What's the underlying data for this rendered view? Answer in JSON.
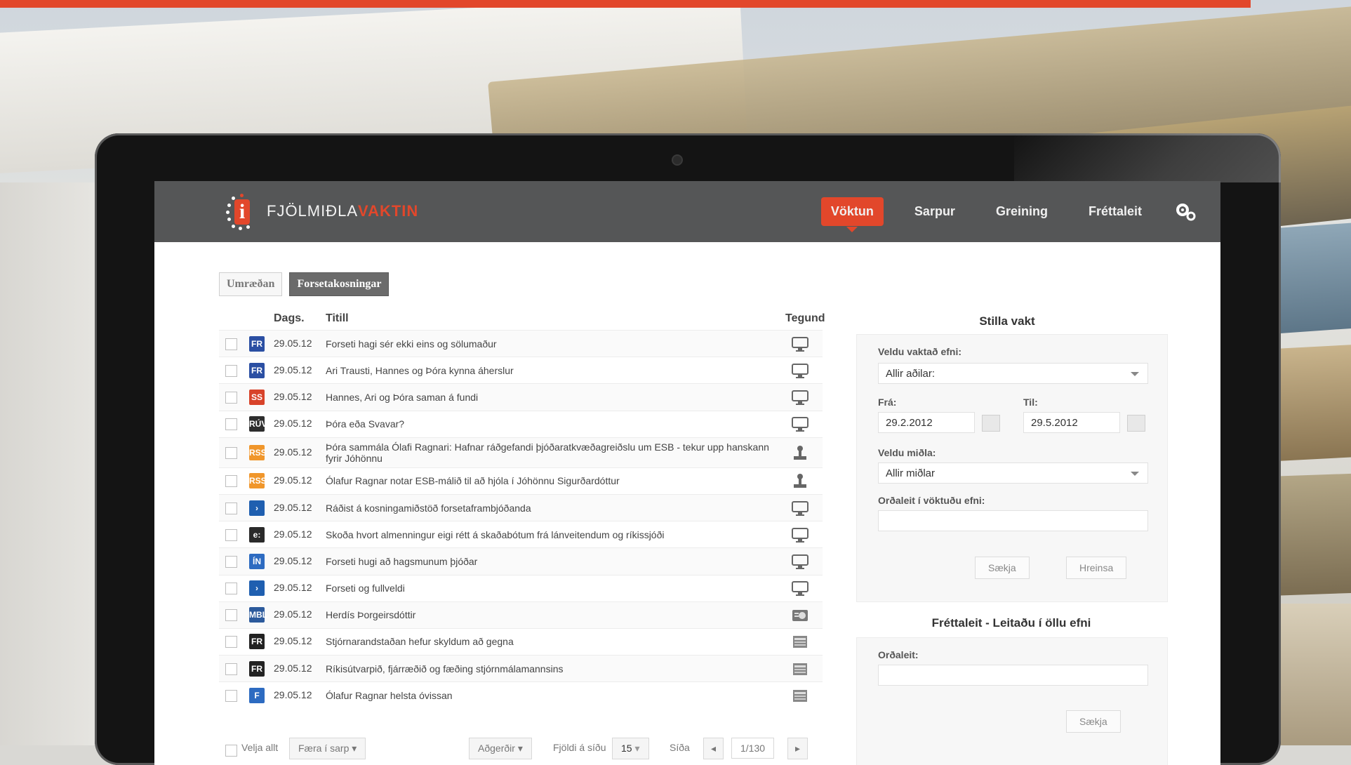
{
  "app": {
    "logo_text_a": "FJÖLMIÐLA",
    "logo_text_b": "VAKTIN"
  },
  "nav": {
    "items": [
      "Vöktun",
      "Sarpur",
      "Greining",
      "Fréttaleit"
    ],
    "active": "Vöktun"
  },
  "tabs": [
    {
      "label": "Umræðan",
      "active": false
    },
    {
      "label": "Forsetakosningar",
      "active": true
    }
  ],
  "list": {
    "headers": {
      "date": "Dags.",
      "title": "Titill",
      "type": "Tegund"
    },
    "rows": [
      {
        "date": "29.05.12",
        "title": "Forseti hagi sér ekki eins og sölumaður",
        "source": "FR",
        "source_color": "#2b4fa3",
        "type": "tv"
      },
      {
        "date": "29.05.12",
        "title": "Ari Trausti, Hannes og Þóra kynna áherslur",
        "source": "FR",
        "source_color": "#2b4fa3",
        "type": "tv"
      },
      {
        "date": "29.05.12",
        "title": "Hannes, Ari og Þóra saman á fundi",
        "source": "SS",
        "source_color": "#d8432a",
        "type": "tv"
      },
      {
        "date": "29.05.12",
        "title": "Þóra eða Svavar?",
        "source": "RÚV",
        "source_color": "#2e2e2e",
        "type": "tv"
      },
      {
        "date": "29.05.12",
        "title": "Þóra sammála Ólafi Ragnari: Hafnar ráðgefandi þjóðaratkvæðagreiðslu um ESB - tekur upp hanskann fyrir Jóhönnu",
        "source": "RSS",
        "source_color": "#f0962b",
        "type": "web"
      },
      {
        "date": "29.05.12",
        "title": "Ólafur Ragnar notar ESB-málið til að hjóla í Jóhönnu Sigurðardóttur",
        "source": "RSS",
        "source_color": "#f0962b",
        "type": "web"
      },
      {
        "date": "29.05.12",
        "title": "Ráðist á kosningamiðstöð forsetaframbjóðanda",
        "source": "›",
        "source_color": "#1f5fb0",
        "type": "tv"
      },
      {
        "date": "29.05.12",
        "title": "Skoða hvort almenningur eigi rétt á skaðabótum frá lánveitendum og ríkissjóði",
        "source": "e:",
        "source_color": "#2a2a2a",
        "type": "tv"
      },
      {
        "date": "29.05.12",
        "title": "Forseti hugi að hagsmunum þjóðar",
        "source": "ÍN",
        "source_color": "#2d6bc1",
        "type": "tv"
      },
      {
        "date": "29.05.12",
        "title": "Forseti og fullveldi",
        "source": "›",
        "source_color": "#1f5fb0",
        "type": "tv"
      },
      {
        "date": "29.05.12",
        "title": "Herdís Þorgeirsdóttir",
        "source": "MBL",
        "source_color": "#2c5a9c",
        "type": "radio"
      },
      {
        "date": "29.05.12",
        "title": "Stjórnarandstaðan hefur skyldum að gegna",
        "source": "FR",
        "source_color": "#222222",
        "type": "print"
      },
      {
        "date": "29.05.12",
        "title": "Ríkisútvarpið, fjárræðið og fæðing stjórnmálamannsins",
        "source": "FR",
        "source_color": "#222222",
        "type": "print"
      },
      {
        "date": "29.05.12",
        "title": "Ólafur Ragnar helsta óvissan",
        "source": "F",
        "source_color": "#2d6bc1",
        "type": "print"
      }
    ]
  },
  "list_footer": {
    "select_all": "Velja allt",
    "move_to_archive": "Færa í sarp",
    "actions": "Aðgerðir",
    "per_page_label": "Fjöldi á síðu",
    "per_page_value": "15",
    "page_label": "Síða",
    "page_value": "1/130"
  },
  "watch_panel": {
    "title": "Stilla vakt",
    "content_label": "Veldu vaktað efni:",
    "content_value": "Allir aðilar:",
    "from_label": "Frá:",
    "from_value": "29.2.2012",
    "to_label": "Til:",
    "to_value": "29.5.2012",
    "media_label": "Veldu miðla:",
    "media_value": "Allir miðlar",
    "keyword_label": "Orðaleit í vöktuðu efni:",
    "fetch_button": "Sækja",
    "clear_button": "Hreinsa"
  },
  "search_panel": {
    "title": "Fréttaleit - Leitaðu í öllu efni",
    "keyword_label": "Orðaleit:",
    "fetch_button": "Sækja"
  },
  "colors": {
    "accent": "#e2472b",
    "header_bg": "#555657"
  }
}
